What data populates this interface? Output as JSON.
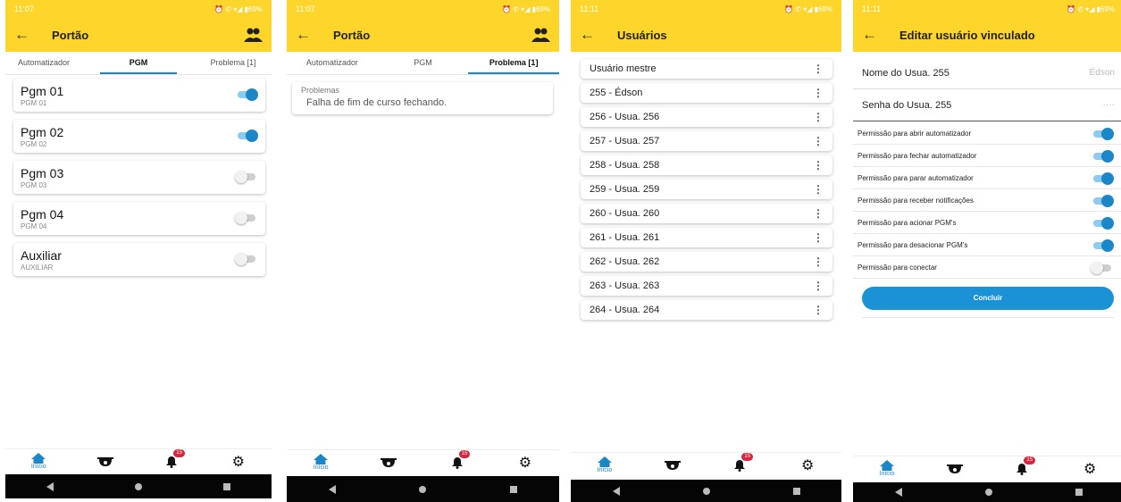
{
  "colors": {
    "accent": "#fed52a",
    "toggle_on": "#1b87c9",
    "badge": "#d7263d"
  },
  "nav": {
    "home_label": "Início",
    "badge_count": "15"
  },
  "screen1": {
    "status_time": "11:07",
    "status_right": "⏰ ✆ ▾◢ ▮69%",
    "title": "Portão",
    "tabs": [
      "Automatizador",
      "PGM",
      "Problema [1]"
    ],
    "pgms": [
      {
        "name": "Pgm 01",
        "sub": "PGM 01",
        "on": true
      },
      {
        "name": "Pgm 02",
        "sub": "PGM 02",
        "on": true
      },
      {
        "name": "Pgm 03",
        "sub": "PGM 03",
        "on": false
      },
      {
        "name": "Pgm 04",
        "sub": "PGM 04",
        "on": false
      },
      {
        "name": "Auxiliar",
        "sub": "AUXILIAR",
        "on": false
      }
    ]
  },
  "screen2": {
    "status_time": "11:07",
    "status_right": "⏰ ✆ ▾◢ ▮69%",
    "title": "Portão",
    "tabs": [
      "Automatizador",
      "PGM",
      "Problema [1]"
    ],
    "problem_label": "Problemas",
    "problem_text": "Falha de fim de curso fechando."
  },
  "screen3": {
    "status_time": "11:11",
    "status_right": "⏰ ✆ ▾◢ ▮69%",
    "title": "Usuários",
    "users": [
      "Usuário mestre",
      "255 - Édson",
      "256 - Usua. 256",
      "257 - Usua. 257",
      "258 - Usua. 258",
      "259 - Usua. 259",
      "260 - Usua. 260",
      "261 - Usua. 261",
      "262 - Usua. 262",
      "263 - Usua. 263",
      "264 - Usua. 264"
    ]
  },
  "screen4": {
    "status_time": "11:11",
    "status_right": "⏰ ✆ ▾◢ ▮69%",
    "title": "Editar usuário vinculado",
    "name_label": "Nome do Usua. 255",
    "name_value": "Édson",
    "password_label": "Senha do Usua. 255",
    "password_value": "····",
    "permissions": [
      {
        "label": "Permissão para abrir automatizador",
        "on": true
      },
      {
        "label": "Permissão para fechar automatizador",
        "on": true
      },
      {
        "label": "Permissão para parar automatizador",
        "on": true
      },
      {
        "label": "Permissão para receber notificações",
        "on": true
      },
      {
        "label": "Permissão para acionar PGM's",
        "on": true
      },
      {
        "label": "Permissão para desacionar PGM's",
        "on": true
      },
      {
        "label": "Permissão para conectar",
        "on": false
      }
    ],
    "button_label": "Concluir"
  }
}
